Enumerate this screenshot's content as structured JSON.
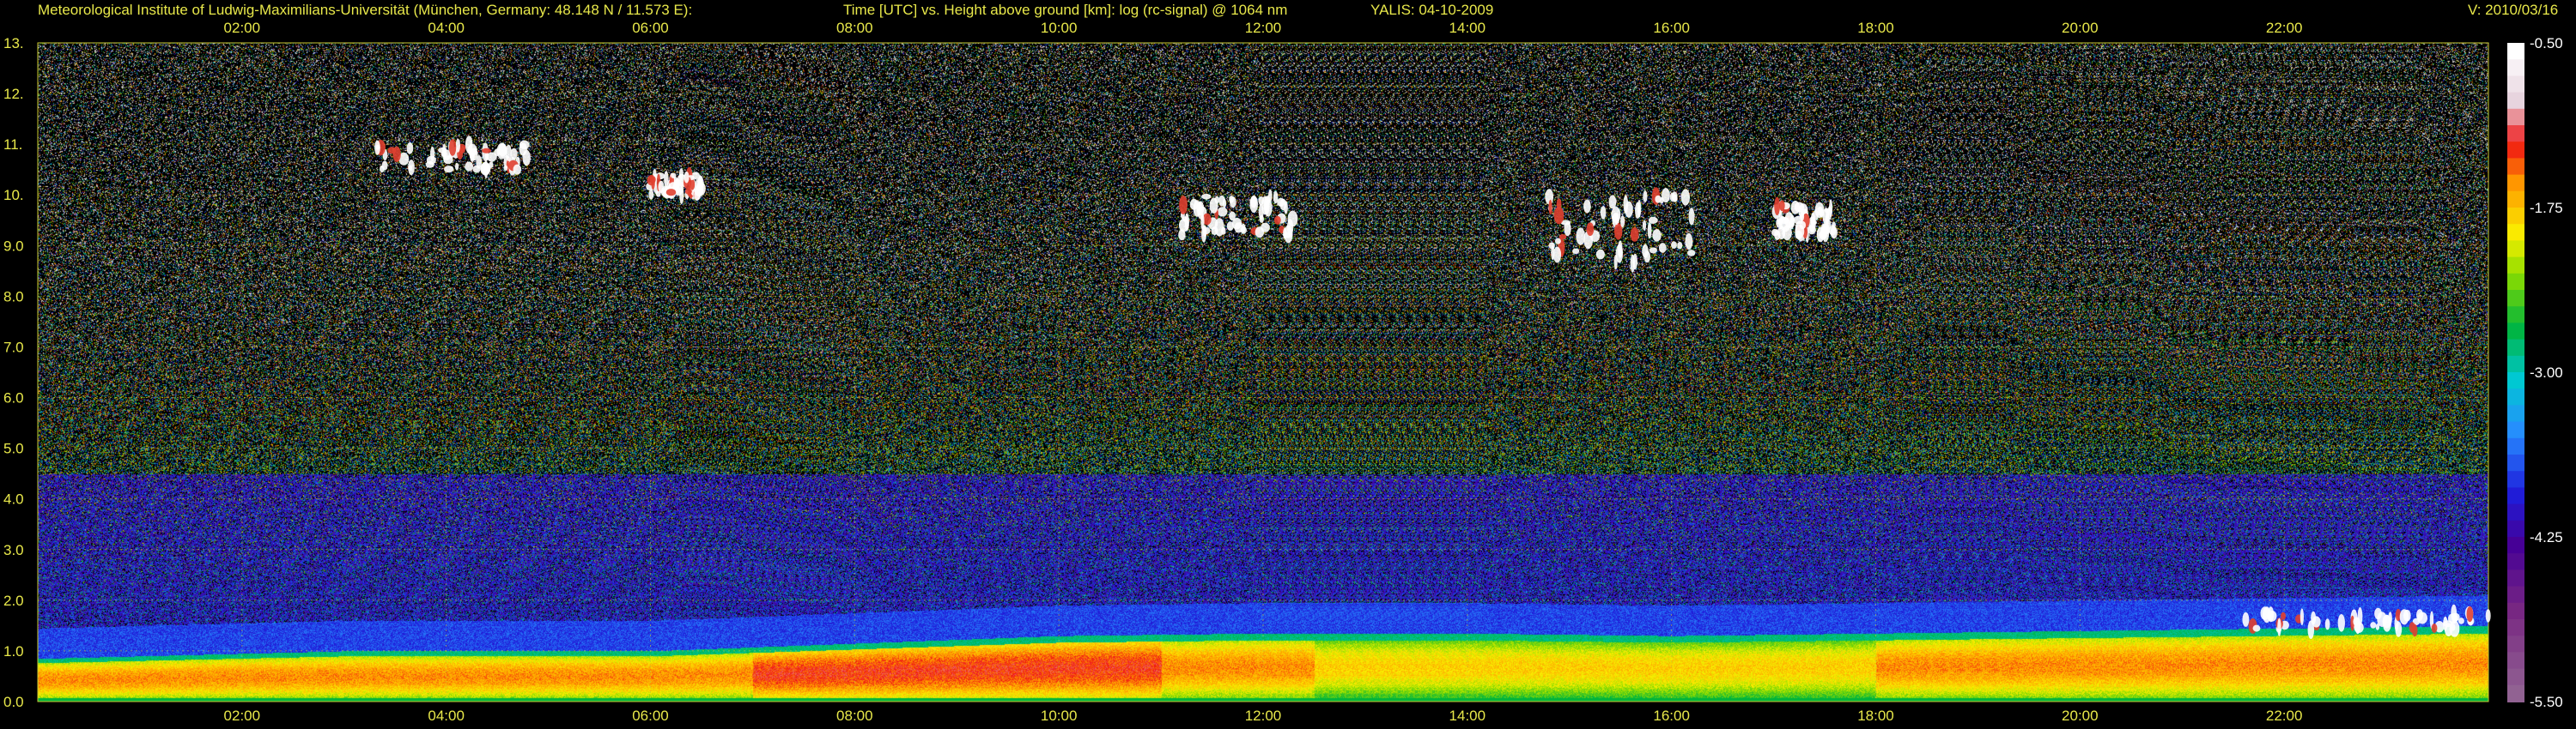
{
  "header": {
    "institute": "Meteorological Institute of Ludwig-Maximilians-Universität (München, Germany: 48.148 N / 11.573 E):",
    "title": "Time [UTC] vs. Height above ground [km]: log (rc-signal) @ 1064 nm",
    "instrument": "YALIS: 04-10-2009",
    "version": "V: 2010/03/16"
  },
  "colors": {
    "text": "#e8e84a",
    "background": "#000000",
    "grid": "#c8c832"
  },
  "chart_data": {
    "type": "heatmap",
    "title": "Time [UTC] vs. Height above ground [km]: log (rc-signal) @ 1064 nm",
    "x_range_hours": [
      0.0,
      24.0
    ],
    "x_ticks": [
      "02:00",
      "04:00",
      "06:00",
      "08:00",
      "10:00",
      "12:00",
      "14:00",
      "16:00",
      "18:00",
      "20:00",
      "22:00"
    ],
    "x_tick_hours": [
      2,
      4,
      6,
      8,
      10,
      12,
      14,
      16,
      18,
      20,
      22
    ],
    "ylim": [
      0.0,
      13.0
    ],
    "y_ticks": [
      "0.0",
      "1.0",
      "2.0",
      "3.0",
      "4.0",
      "5.0",
      "6.0",
      "7.0",
      "8.0",
      "9.0",
      "10.",
      "11.",
      "12.",
      "13."
    ],
    "y_tick_values": [
      0,
      1,
      2,
      3,
      4,
      5,
      6,
      7,
      8,
      9,
      10,
      11,
      12,
      13
    ],
    "grid": true,
    "colorbar": {
      "range": [
        -5.5,
        -0.5
      ],
      "ticks": [
        "-0.50",
        "-1.75",
        "-3.00",
        "-4.25",
        "-5.50"
      ],
      "tick_values": [
        -0.5,
        -1.75,
        -3.0,
        -4.25,
        -5.5
      ]
    },
    "boundary_layer_top_km": [
      {
        "t": 0.0,
        "h": 0.85
      },
      {
        "t": 1.0,
        "h": 0.9
      },
      {
        "t": 3.0,
        "h": 1.0
      },
      {
        "t": 6.0,
        "h": 1.0
      },
      {
        "t": 8.0,
        "h": 1.15
      },
      {
        "t": 10.0,
        "h": 1.3
      },
      {
        "t": 12.0,
        "h": 1.35
      },
      {
        "t": 14.0,
        "h": 1.35
      },
      {
        "t": 16.0,
        "h": 1.3
      },
      {
        "t": 18.0,
        "h": 1.35
      },
      {
        "t": 20.0,
        "h": 1.4
      },
      {
        "t": 22.0,
        "h": 1.45
      },
      {
        "t": 24.0,
        "h": 1.5
      }
    ],
    "cloud_features": [
      {
        "t_start": 3.3,
        "t_end": 4.8,
        "h_low": 10.5,
        "h_high": 11.0
      },
      {
        "t_start": 6.0,
        "t_end": 6.5,
        "h_low": 10.0,
        "h_high": 10.4
      },
      {
        "t_start": 11.2,
        "t_end": 12.3,
        "h_low": 9.2,
        "h_high": 10.0
      },
      {
        "t_start": 14.8,
        "t_end": 16.2,
        "h_low": 8.6,
        "h_high": 10.0
      },
      {
        "t_start": 17.0,
        "t_end": 17.6,
        "h_low": 9.2,
        "h_high": 9.8
      },
      {
        "t_start": 21.6,
        "t_end": 24.0,
        "h_low": 1.4,
        "h_high": 1.75
      }
    ]
  }
}
